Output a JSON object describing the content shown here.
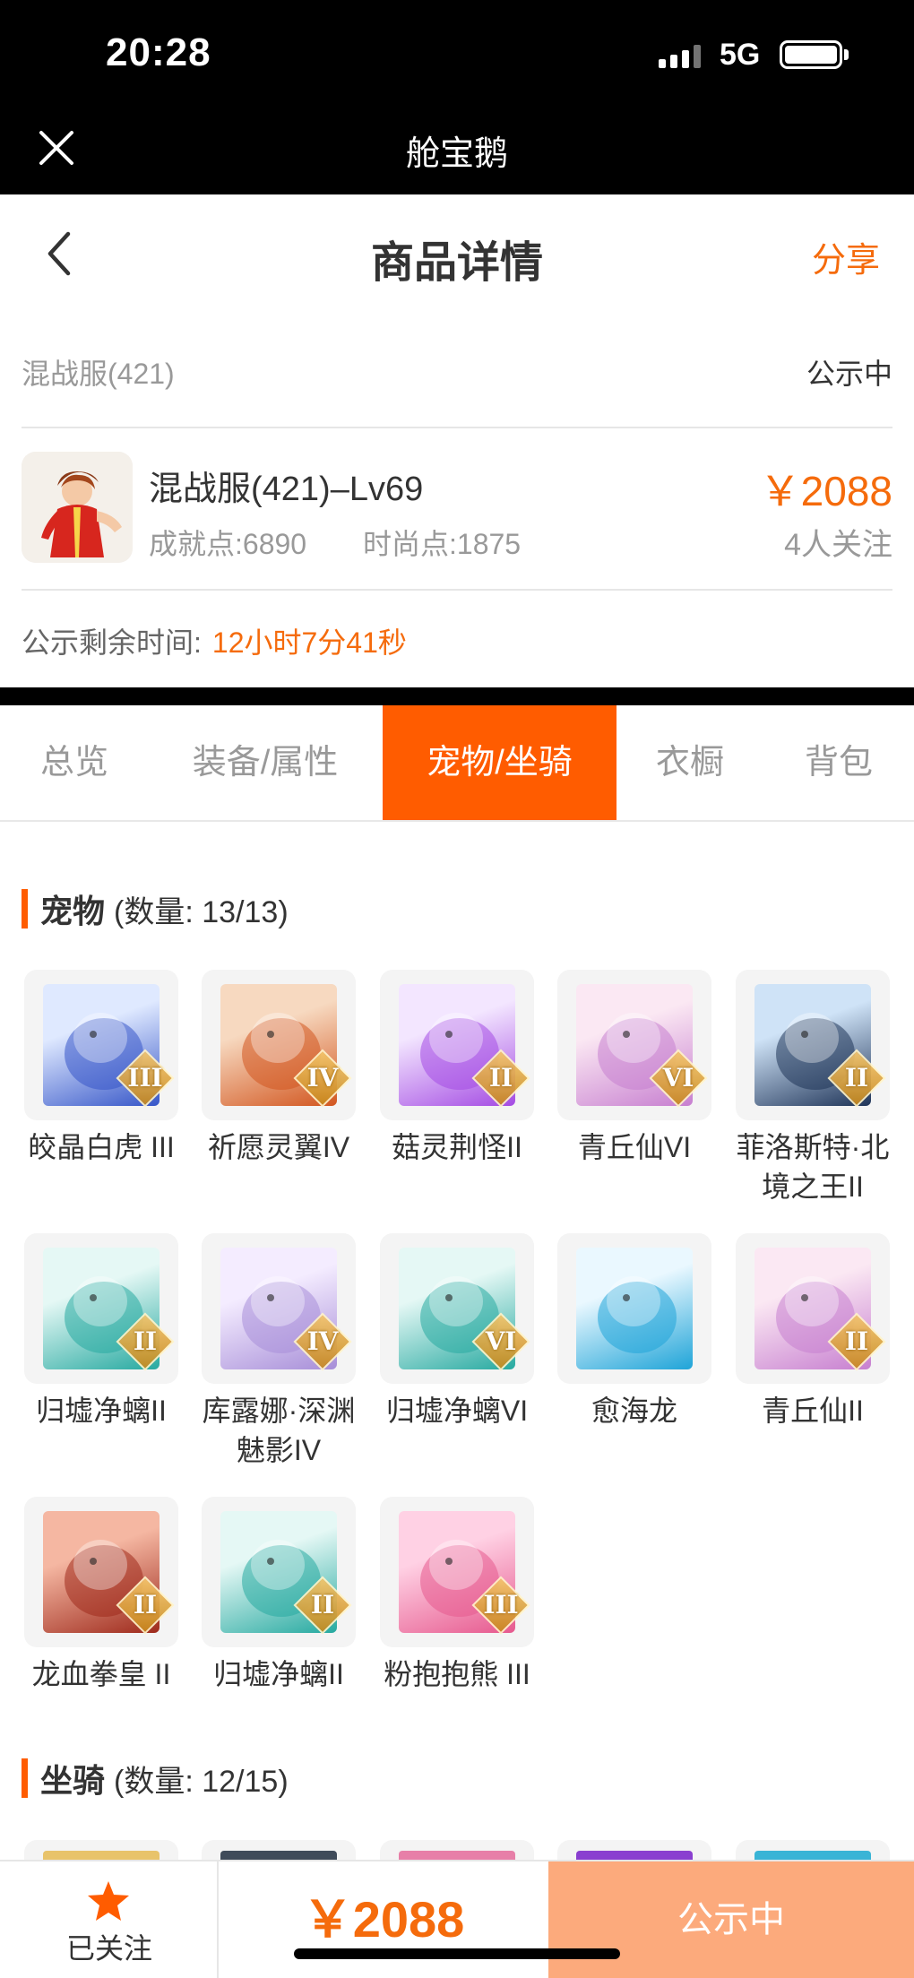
{
  "status_bar": {
    "time": "20:28",
    "network": "5G"
  },
  "app_bar": {
    "title": "舱宝鹅"
  },
  "header": {
    "title": "商品详情",
    "share": "分享"
  },
  "product": {
    "server": "混战服(421)",
    "status": "公示中",
    "name": "混战服(421)–Lv69",
    "achievement": "成就点:6890",
    "fashion": "时尚点:1875",
    "price": "￥2088",
    "followers": "4人关注",
    "countdown_label": "公示剩余时间:",
    "countdown_value": "12小时7分41秒"
  },
  "tabs": [
    {
      "label": "总览",
      "active": false
    },
    {
      "label": "装备/属性",
      "active": false
    },
    {
      "label": "宠物/坐骑",
      "active": true
    },
    {
      "label": "衣橱",
      "active": false
    },
    {
      "label": "背包",
      "active": false
    }
  ],
  "pets_section": {
    "title": "宠物",
    "count": "(数量: 13/13)",
    "items": [
      {
        "name": "皎晶白虎 III",
        "badge": "III",
        "icon": "white-tiger-icon",
        "colors": [
          "#dfe9ff",
          "#3656c8"
        ]
      },
      {
        "name": "祈愿灵翼IV",
        "badge": "IV",
        "icon": "griffin-icon",
        "colors": [
          "#f7d9c0",
          "#d2561f"
        ]
      },
      {
        "name": "菇灵荆怪II",
        "badge": "II",
        "icon": "mushroom-sprite-icon",
        "colors": [
          "#f3e6ff",
          "#a44be3"
        ]
      },
      {
        "name": "青丘仙VI",
        "badge": "VI",
        "icon": "fox-fairy-icon",
        "colors": [
          "#fbe8f3",
          "#c77fd0"
        ]
      },
      {
        "name": "菲洛斯特·北境之王II",
        "badge": "II",
        "icon": "ice-king-icon",
        "colors": [
          "#cfe3f7",
          "#1f3458"
        ]
      },
      {
        "name": "归墟净螭II",
        "badge": "II",
        "icon": "jade-dragon-icon",
        "colors": [
          "#e5f8f5",
          "#26a9a0"
        ]
      },
      {
        "name": "库露娜·深渊魅影IV",
        "badge": "IV",
        "icon": "abyss-phantom-icon",
        "colors": [
          "#f4ecff",
          "#a78ed8"
        ]
      },
      {
        "name": "归墟净螭VI",
        "badge": "VI",
        "icon": "jade-dragon-icon",
        "colors": [
          "#e5f8f5",
          "#26a9a0"
        ]
      },
      {
        "name": "愈海龙",
        "badge": "",
        "icon": "sea-dragon-icon",
        "colors": [
          "#eaf8ff",
          "#1fa4d8"
        ]
      },
      {
        "name": "青丘仙II",
        "badge": "II",
        "icon": "fox-fairy-icon",
        "colors": [
          "#fbe8f3",
          "#c77fd0"
        ]
      },
      {
        "name": "龙血拳皇 II",
        "badge": "II",
        "icon": "dragon-fist-icon",
        "colors": [
          "#f5b7a2",
          "#9e2a1c"
        ]
      },
      {
        "name": "归墟净螭II",
        "badge": "II",
        "icon": "jade-dragon-icon",
        "colors": [
          "#e5f8f5",
          "#26a9a0"
        ]
      },
      {
        "name": "粉抱抱熊 III",
        "badge": "III",
        "icon": "pink-bear-icon",
        "colors": [
          "#ffd1e4",
          "#e6598e"
        ]
      }
    ]
  },
  "mounts_section": {
    "title": "坐骑",
    "count": "(数量: 12/15)",
    "partial_colors": [
      "#e8c36a",
      "#3f4b5a",
      "#e77fa8",
      "#8a3fd0",
      "#39b4d6"
    ]
  },
  "bottom_bar": {
    "follow_label": "已关注",
    "price": "￥2088",
    "status_button": "公示中"
  },
  "colors": {
    "accent": "#ff5c00",
    "price": "#f56b0c",
    "button": "#fcaa7c"
  }
}
